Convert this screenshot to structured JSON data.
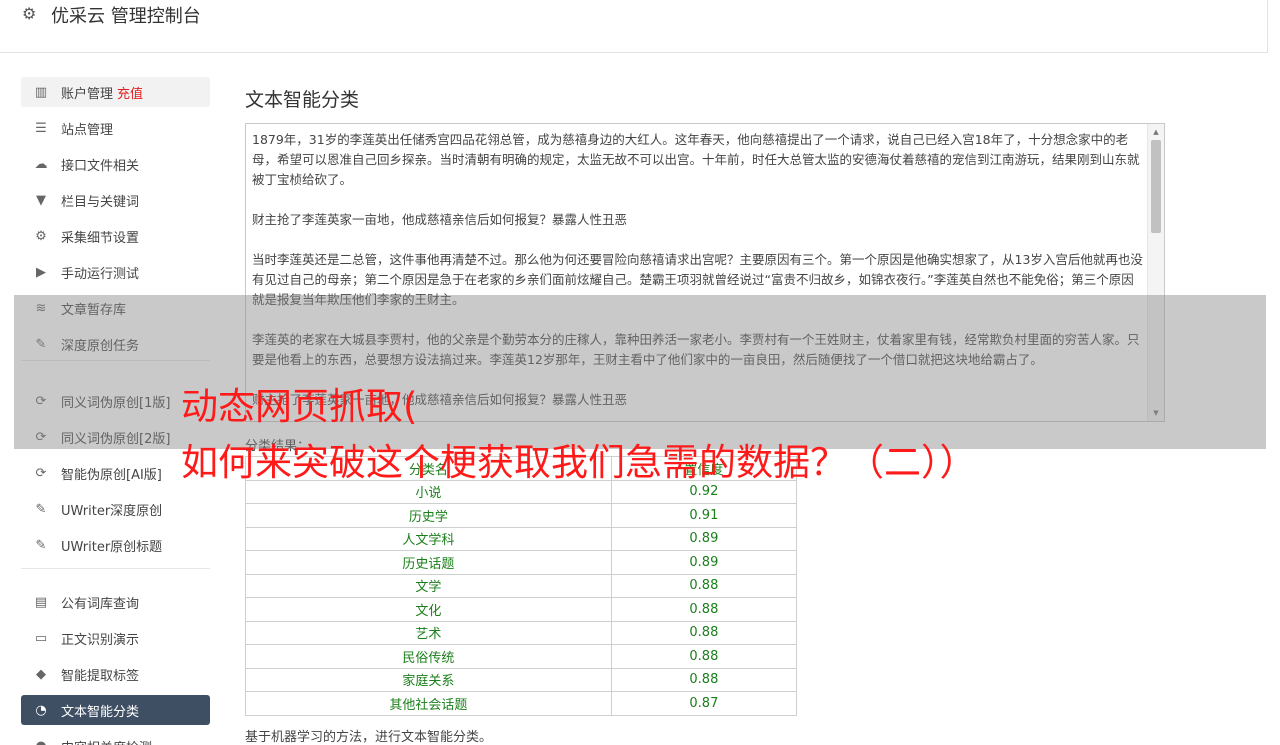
{
  "app": {
    "title": "优采云 管理控制台",
    "settings_icon": "gear-icon"
  },
  "sidebar": {
    "items": [
      {
        "label": "账户管理",
        "badge": "充值",
        "icon": "bar-chart-icon",
        "icon_glyph": "▥"
      },
      {
        "label": "站点管理",
        "icon": "server-icon",
        "icon_glyph": "☰"
      },
      {
        "label": "接口文件相关",
        "icon": "cloud-upload-icon",
        "icon_glyph": "☁"
      },
      {
        "label": "栏目与关键词",
        "icon": "filter-icon",
        "icon_glyph": "▼"
      },
      {
        "label": "采集细节设置",
        "icon": "cogs-icon",
        "icon_glyph": "⚙"
      },
      {
        "label": "手动运行测试",
        "icon": "play-circle-icon",
        "icon_glyph": "▶"
      },
      {
        "label": "文章暂存库",
        "icon": "database-icon",
        "icon_glyph": "≋"
      },
      {
        "label": "深度原创任务",
        "icon": "edit-icon",
        "icon_glyph": "✎"
      },
      {
        "label": "同义词伪原创[1版]",
        "icon": "refresh-icon",
        "icon_glyph": "⟳"
      },
      {
        "label": "同义词伪原创[2版]",
        "icon": "refresh-icon",
        "icon_glyph": "⟳"
      },
      {
        "label": "智能伪原创[AI版]",
        "icon": "refresh-icon",
        "icon_glyph": "⟳"
      },
      {
        "label": "UWriter深度原创",
        "icon": "edit-icon",
        "icon_glyph": "✎"
      },
      {
        "label": "UWriter原创标题",
        "icon": "edit-icon",
        "icon_glyph": "✎"
      },
      {
        "label": "公有词库查询",
        "icon": "book-icon",
        "icon_glyph": "▤"
      },
      {
        "label": "正文识别演示",
        "icon": "monitor-icon",
        "icon_glyph": "▭"
      },
      {
        "label": "智能提取标签",
        "icon": "tag-icon",
        "icon_glyph": "◆"
      },
      {
        "label": "文本智能分类",
        "icon": "pie-chart-icon",
        "icon_glyph": "◔"
      },
      {
        "label": "内容相关度检测",
        "icon": "user-icon",
        "icon_glyph": "●"
      }
    ]
  },
  "main": {
    "title": "文本智能分类",
    "text_paragraphs": [
      "1879年，31岁的李莲英出任储秀宫四品花翎总管，成为慈禧身边的大红人。这年春天，他向慈禧提出了一个请求，说自己已经入宫18年了，十分想念家中的老母，希望可以恩准自己回乡探亲。当时清朝有明确的规定，太监无故不可以出宫。十年前，时任大总管太监的安德海仗着慈禧的宠信到江南游玩，结果刚到山东就被丁宝桢给砍了。",
      "财主抢了李莲英家一亩地，他成慈禧亲信后如何报复？暴露人性丑恶",
      "当时李莲英还是二总管，这件事他再清楚不过。那么他为何还要冒险向慈禧请求出宫呢？主要原因有三个。第一个原因是他确实想家了，从13岁入宫后他就再也没有见过自己的母亲；第二个原因是急于在老家的乡亲们面前炫耀自己。楚霸王项羽就曾经说过“富贵不归故乡，如锦衣夜行。”李莲英自然也不能免俗；第三个原因就是报复当年欺压他们李家的王财主。",
      "李莲英的老家在大城县李贾村，他的父亲是个勤劳本分的庄稼人，靠种田养活一家老小。李贾村有一个王姓财主，仗着家里有钱，经常欺负村里面的穷苦人家。只要是他看上的东西，总要想方设法搞过来。李莲英12岁那年，王财主看中了他们家中的一亩良田，然后随便找了一个借口就把这块地给霸占了。",
      "财主抢了李莲英家一亩地，他成慈禧亲信后如何报复？暴露人性丑恶"
    ],
    "result_label": "分类结果：",
    "table": {
      "headers": [
        "分类名",
        "置信度"
      ],
      "rows": [
        [
          "小说",
          "0.92"
        ],
        [
          "历史学",
          "0.91"
        ],
        [
          "人文学科",
          "0.89"
        ],
        [
          "历史话题",
          "0.89"
        ],
        [
          "文学",
          "0.88"
        ],
        [
          "文化",
          "0.88"
        ],
        [
          "艺术",
          "0.88"
        ],
        [
          "民俗传统",
          "0.88"
        ],
        [
          "家庭关系",
          "0.88"
        ],
        [
          "其他社会话题",
          "0.87"
        ]
      ]
    },
    "footnote": "基于机器学习的方法，进行文本智能分类。"
  },
  "overlay": {
    "headline_line1": "动态网页抓取(",
    "headline_line2": "如何来突破这个梗获取我们急需的数据？（二））"
  },
  "colors": {
    "active_nav": "#3f4f63",
    "badge": "#e02020",
    "table_text": "#1a7f1a",
    "headline": "#ff1a1a"
  }
}
